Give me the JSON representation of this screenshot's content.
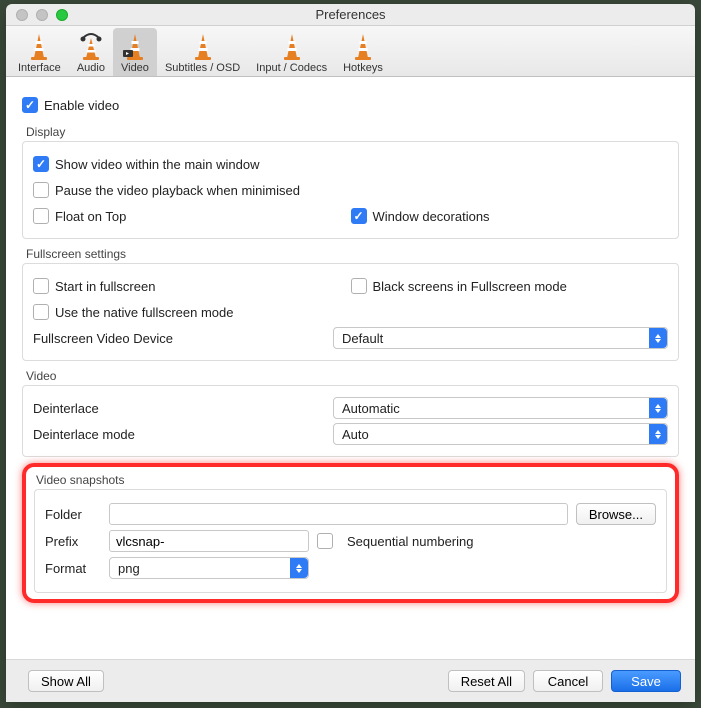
{
  "window": {
    "title": "Preferences"
  },
  "toolbar": {
    "items": [
      {
        "label": "Interface"
      },
      {
        "label": "Audio"
      },
      {
        "label": "Video"
      },
      {
        "label": "Subtitles / OSD"
      },
      {
        "label": "Input / Codecs"
      },
      {
        "label": "Hotkeys"
      }
    ]
  },
  "enable_video": {
    "label": "Enable video",
    "checked": true
  },
  "display": {
    "group_label": "Display",
    "show_in_main": {
      "label": "Show video within the main window",
      "checked": true
    },
    "pause_minimised": {
      "label": "Pause the video playback when minimised",
      "checked": false
    },
    "float_on_top": {
      "label": "Float on Top",
      "checked": false
    },
    "window_decorations": {
      "label": "Window decorations",
      "checked": true
    }
  },
  "fullscreen": {
    "group_label": "Fullscreen settings",
    "start_fullscreen": {
      "label": "Start in fullscreen",
      "checked": false
    },
    "black_screens": {
      "label": "Black screens in Fullscreen mode",
      "checked": false
    },
    "native_mode": {
      "label": "Use the native fullscreen mode",
      "checked": false
    },
    "device_label": "Fullscreen Video Device",
    "device_value": "Default"
  },
  "video": {
    "group_label": "Video",
    "deinterlace_label": "Deinterlace",
    "deinterlace_value": "Automatic",
    "mode_label": "Deinterlace mode",
    "mode_value": "Auto"
  },
  "snapshots": {
    "group_label": "Video snapshots",
    "folder_label": "Folder",
    "folder_value": "",
    "browse": "Browse...",
    "prefix_label": "Prefix",
    "prefix_value": "vlcsnap-",
    "sequential": {
      "label": "Sequential numbering",
      "checked": false
    },
    "format_label": "Format",
    "format_value": "png"
  },
  "footer": {
    "show_all": "Show All",
    "reset_all": "Reset All",
    "cancel": "Cancel",
    "save": "Save"
  }
}
